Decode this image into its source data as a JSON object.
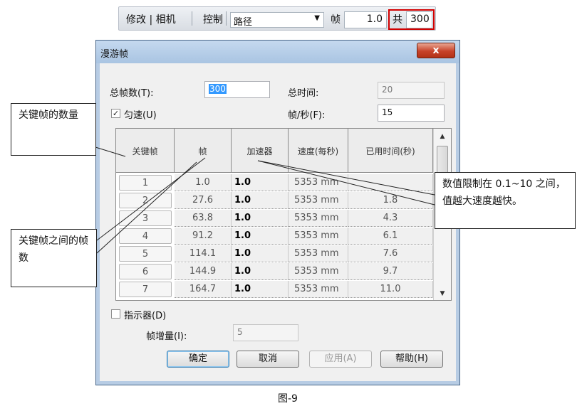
{
  "toolbar": {
    "modify_camera": "修改 | 相机",
    "control_label": "控制",
    "control_value": "路径",
    "frame_label": "帧",
    "frame_value": "1.0",
    "total_label": "共",
    "total_value": "300"
  },
  "dialog": {
    "title": "漫游帧",
    "close_label": "x",
    "total_frames_label": "总帧数(T):",
    "total_frames_value": "300",
    "total_time_label": "总时间:",
    "total_time_value": "20",
    "uniform_label": "匀速(U)",
    "fps_label": "帧/秒(F):",
    "fps_value": "15",
    "columns": [
      "关键帧",
      "帧",
      "加速器",
      "速度(每秒)",
      "已用时间(秒)"
    ],
    "rows": [
      {
        "key": "1",
        "frame": "1.0",
        "accel": "1.0",
        "speed": "5353 mm",
        "elapsed": ""
      },
      {
        "key": "2",
        "frame": "27.6",
        "accel": "1.0",
        "speed": "5353 mm",
        "elapsed": "1.8"
      },
      {
        "key": "3",
        "frame": "63.8",
        "accel": "1.0",
        "speed": "5353 mm",
        "elapsed": "4.3"
      },
      {
        "key": "4",
        "frame": "91.2",
        "accel": "1.0",
        "speed": "5353 mm",
        "elapsed": "6.1"
      },
      {
        "key": "5",
        "frame": "114.1",
        "accel": "1.0",
        "speed": "5353 mm",
        "elapsed": "7.6"
      },
      {
        "key": "6",
        "frame": "144.9",
        "accel": "1.0",
        "speed": "5353 mm",
        "elapsed": "9.7"
      },
      {
        "key": "7",
        "frame": "164.7",
        "accel": "1.0",
        "speed": "5353 mm",
        "elapsed": "11.0"
      }
    ],
    "indicator_label": "指示器(D)",
    "frame_increment_label": "帧增量(I):",
    "frame_increment_value": "5",
    "buttons": {
      "ok": "确定",
      "cancel": "取消",
      "apply": "应用(A)",
      "help": "帮助(H)"
    }
  },
  "callouts": {
    "keyframe_count": "关键帧的数量",
    "frames_between": "关键帧之间的帧数",
    "value_limit": "数值限制在 0.1~10 之间，值越大速度越快。"
  },
  "caption": "图-9"
}
